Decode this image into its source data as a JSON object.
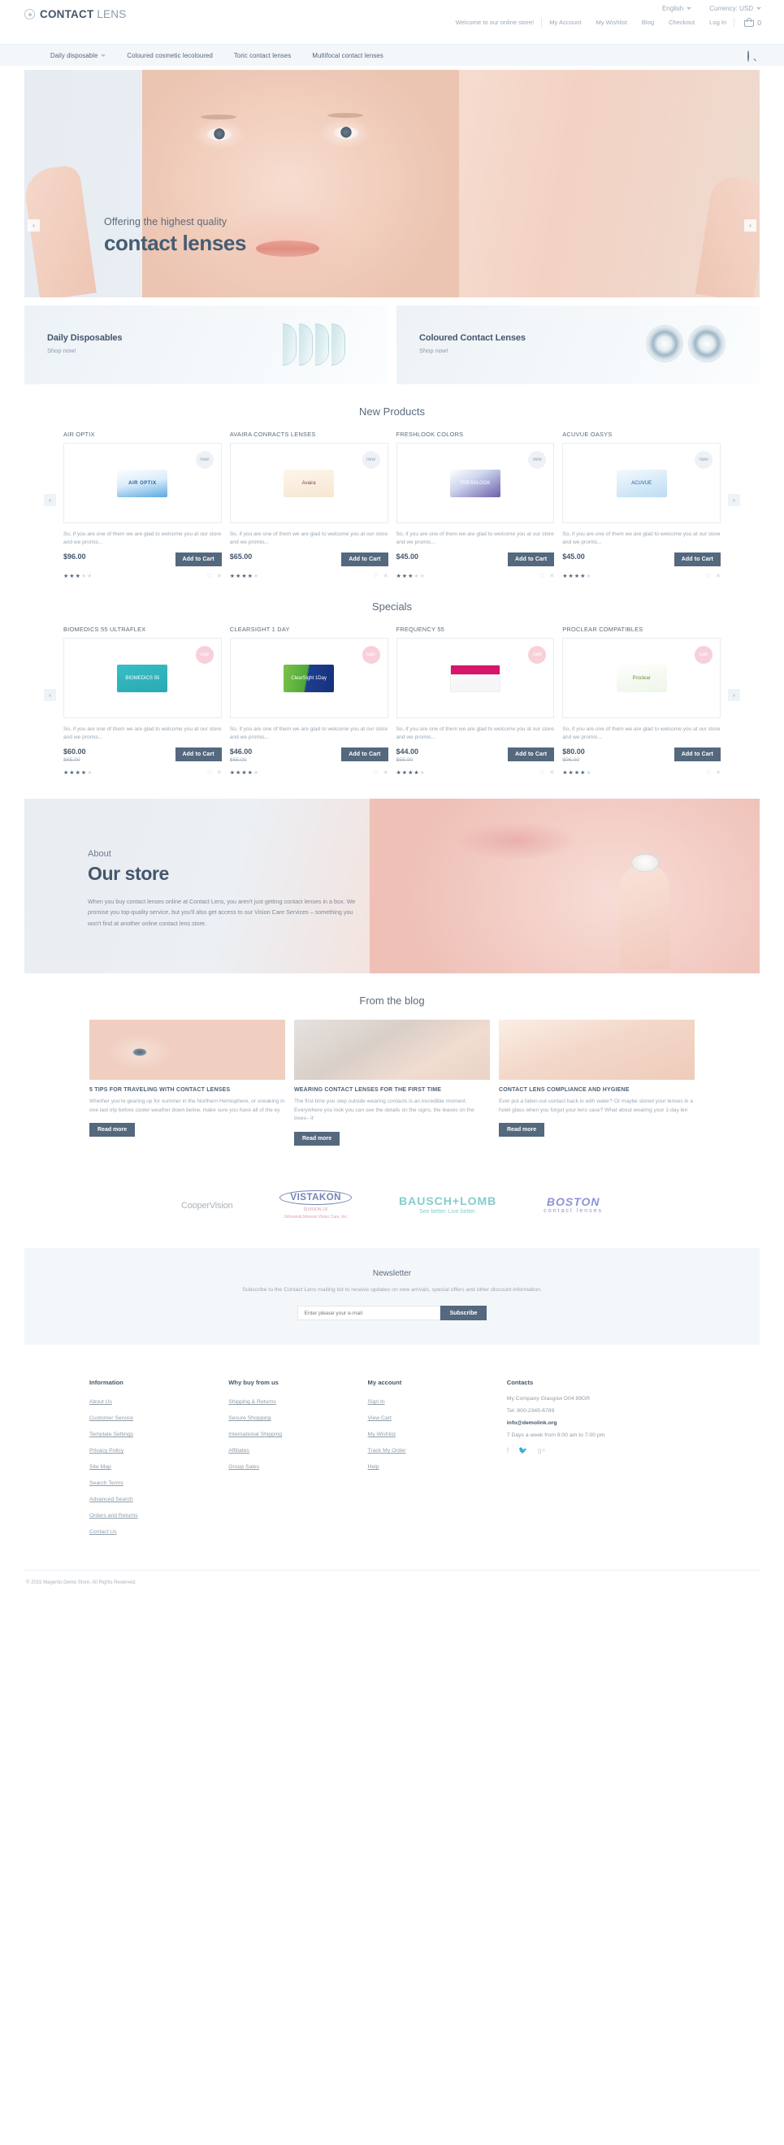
{
  "header": {
    "logo": {
      "primary": "CONTACT",
      "secondary": "LENS"
    },
    "language": {
      "label": "English"
    },
    "currency": {
      "label": "Currency: USD"
    },
    "welcome": "Welcome to our online store!",
    "links": [
      "My Account",
      "My Wishlist",
      "Blog",
      "Checkout",
      "Log In"
    ],
    "cart_count": "0"
  },
  "nav": {
    "items": [
      {
        "label": "Daily disposable",
        "has_caret": true
      },
      {
        "label": "Coloured cosmetic lecoloured",
        "has_caret": false
      },
      {
        "label": "Toric contact lenses",
        "has_caret": false
      },
      {
        "label": "Multifocal contact lenses",
        "has_caret": false
      }
    ],
    "search_icon": "search-icon"
  },
  "hero": {
    "subtitle": "Offering the highest quality",
    "title": "contact lenses",
    "prev": "‹",
    "next": "›"
  },
  "promos": [
    {
      "title": "Daily Disposables",
      "sub": "Shop now!"
    },
    {
      "title": "Coloured Contact Lenses",
      "sub": "Shop now!"
    }
  ],
  "new_products": {
    "heading": "New Products",
    "prev": "‹",
    "next": "›",
    "items": [
      {
        "name": "AIR OPTIX",
        "badge": "new",
        "badge_type": "new",
        "desc": "So, if you are one of them we are glad to welcome you at our store and we promis...",
        "price": "$96.00",
        "old_price": "",
        "cart": "Add to Cart",
        "rating": 3,
        "box_class": "b-airoptix",
        "box_text": "AIR OPTIX"
      },
      {
        "name": "AVAIRA CONRACTS LENSES",
        "badge": "new",
        "badge_type": "new",
        "desc": "So, if you are one of them we are glad to welcome you at our store and we promis...",
        "price": "$65.00",
        "old_price": "",
        "cart": "Add to Cart",
        "rating": 4,
        "box_class": "b-avaira",
        "box_text": "Avaira"
      },
      {
        "name": "FRESHLOOK COLORS",
        "badge": "new",
        "badge_type": "new",
        "desc": "So, if you are one of them we are glad to welcome you at our store and we promis...",
        "price": "$45.00",
        "old_price": "",
        "cart": "Add to Cart",
        "rating": 3,
        "box_class": "b-freshlook",
        "box_text": "FRESHLOOK"
      },
      {
        "name": "ACUVUE OASYS",
        "badge": "new",
        "badge_type": "new",
        "desc": "So, if you are one of them we are glad to welcome you at our store and we promis...",
        "price": "$45.00",
        "old_price": "",
        "cart": "Add to Cart",
        "rating": 4,
        "box_class": "b-acuvue",
        "box_text": "ACUVUE"
      }
    ]
  },
  "specials": {
    "heading": "Specials",
    "prev": "‹",
    "next": "›",
    "items": [
      {
        "name": "BIOMEDICS 55 ULTRAFLEX",
        "badge": "sale",
        "badge_type": "sale",
        "desc": "So, if you are one of them we are glad to welcome you at our store and we promis...",
        "price": "$60.00",
        "old_price": "$65.00",
        "cart": "Add to Cart",
        "rating": 4,
        "box_class": "b-biomedics",
        "box_text": "BIOMEDICS 55"
      },
      {
        "name": "CLEARSIGHT 1 DAY",
        "badge": "sale",
        "badge_type": "sale",
        "desc": "So, if you are one of them we are glad to welcome you at our store and we promis...",
        "price": "$46.00",
        "old_price": "$65.00",
        "cart": "Add to Cart",
        "rating": 4,
        "box_class": "b-clearsight",
        "box_text": "ClearSight 1Day"
      },
      {
        "name": "FREQUENCY 55",
        "badge": "sale",
        "badge_type": "sale",
        "desc": "So, if you are one of them we are glad to welcome you at our store and we promis...",
        "price": "$44.00",
        "old_price": "$55.00",
        "cart": "Add to Cart",
        "rating": 4,
        "box_class": "b-frequency",
        "box_text": ""
      },
      {
        "name": "PROCLEAR COMPATIBLES",
        "badge": "sale",
        "badge_type": "sale",
        "desc": "So, if you are one of them we are glad to welcome you at our store and we promis...",
        "price": "$80.00",
        "old_price": "$96.00",
        "cart": "Add to Cart",
        "rating": 4,
        "box_class": "b-proclear",
        "box_text": "Proclear"
      }
    ]
  },
  "about": {
    "kicker": "About",
    "title": "Our store",
    "body": "When you buy contact lenses online at Contact Lens, you aren't just getting contact lenses in a box. We promise you top-quality service, but you'll also get access to our Vision Care Services – something you won't find at another online contact lens store."
  },
  "blog": {
    "heading": "From the blog",
    "posts": [
      {
        "title": "5 TIPS FOR TRAVELING WITH CONTACT LENSES",
        "excerpt": "Whether you're gearing up for summer in the Northern Hemisphere, or sneaking in one last trip before cooler weather down below, make sure you have all of the ey",
        "button": "Read more"
      },
      {
        "title": "WEARING CONTACT LENSES FOR THE FIRST TIME",
        "excerpt": "The first time you step outside wearing contacts is an incredible moment. Everywhere you look you can see the details on the signs, the leaves on the trees– it'",
        "button": "Read more"
      },
      {
        "title": "CONTACT LENS COMPLIANCE AND HYGIENE",
        "excerpt": "Ever put a fallen-out contact back in with water? Or maybe stored your lenses in a hotel glass when you forgot your lens case? What about wearing your 1-day len",
        "button": "Read more"
      }
    ]
  },
  "brands": [
    {
      "name": "CooperVision"
    },
    {
      "name": "VISTAKON",
      "sub1": "DIVISION OF",
      "sub2": "Johnson&Johnson Vision Care, Inc."
    },
    {
      "name": "BAUSCH+LOMB",
      "tagline": "See better. Live better."
    },
    {
      "name": "BOSTON",
      "tagline": "contact lenses"
    }
  ],
  "newsletter": {
    "title": "Newsletter",
    "subtitle": "Subscribe to the Contact Lens mailing list to receive updates on new arrivals, special offers and other discount information.",
    "placeholder": "Enter please your e-mail",
    "button": "Subscribe"
  },
  "footer": {
    "columns": [
      {
        "heading": "Information",
        "links": [
          "About Us",
          "Customer Service",
          "Template Settings",
          "Privacy Policy",
          "Site Map",
          "Search Terms",
          "Advanced Search",
          "Orders and Returns",
          "Contact Us"
        ]
      },
      {
        "heading": "Why buy from us",
        "links": [
          "Shipping & Returns",
          "Secure Shopping",
          "International Shipping",
          "Affiliates",
          "Group Sales"
        ]
      },
      {
        "heading": "My account",
        "links": [
          "Sign In",
          "View Cart",
          "My Wishlist",
          "Track My Order",
          "Help"
        ]
      }
    ],
    "contacts": {
      "heading": "Contacts",
      "address": "My Company Glasgow D04 89GR",
      "tel": "Tel: 800-2345-6789",
      "email": "info@demolink.org",
      "hours": "7 Days a week from 9:00 am to 7:00 pm",
      "socials": [
        "f",
        "🐦",
        "g+"
      ]
    },
    "copyright": "© 2015 Magento Demo Store. All Rights Reserved."
  }
}
